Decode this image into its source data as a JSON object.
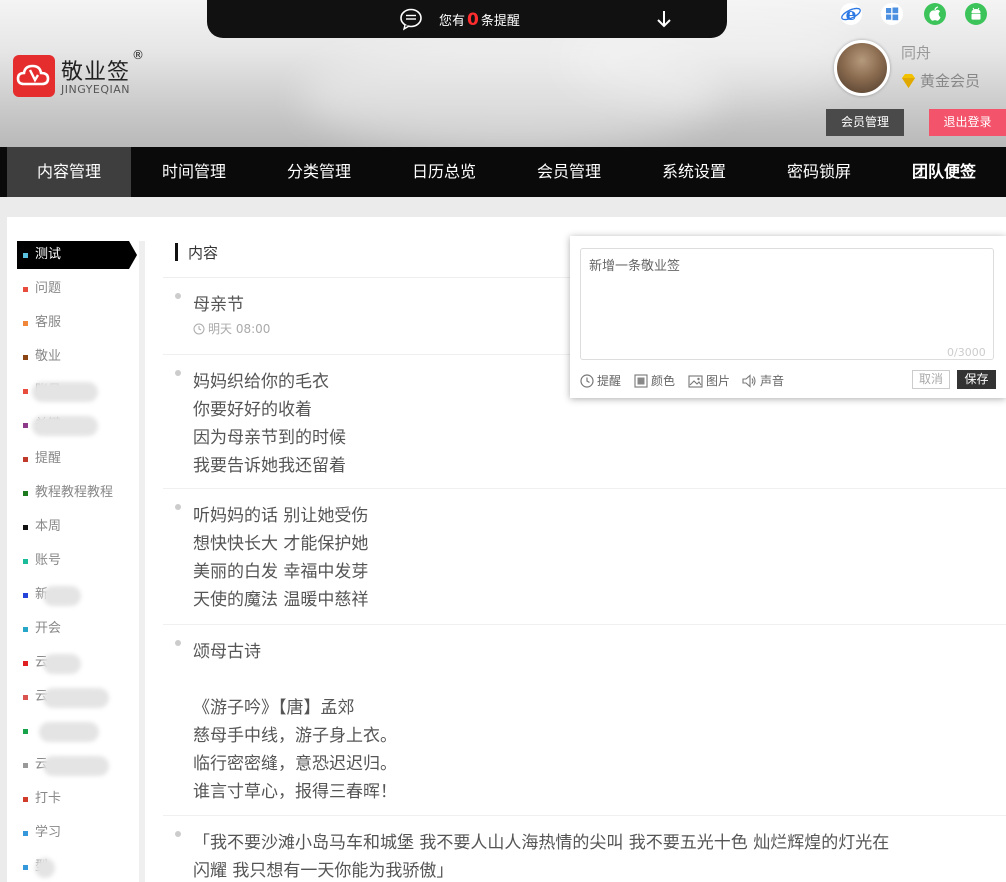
{
  "reminder": {
    "prefix": "您有",
    "count": "0",
    "suffix": "条提醒"
  },
  "logo": {
    "name": "敬业签",
    "reg": "®",
    "sub": "JINGYEQIAN"
  },
  "user": {
    "name": "同舟",
    "level": "黄金会员"
  },
  "buttons": {
    "member": "会员管理",
    "logout": "退出登录"
  },
  "nav": [
    "内容管理",
    "时间管理",
    "分类管理",
    "日历总览",
    "会员管理",
    "系统设置",
    "密码锁屏",
    "团队便签"
  ],
  "sidebar": {
    "items": [
      {
        "label": "测试",
        "color": "#5bc0de"
      },
      {
        "label": "问题",
        "color": "#e74c3c"
      },
      {
        "label": "客服",
        "color": "#f0863a"
      },
      {
        "label": "敬业",
        "color": "#8b4513"
      },
      {
        "label": "账号",
        "color": "#e74c3c"
      },
      {
        "label": "关键...",
        "color": "#8e3a8a"
      },
      {
        "label": "提醒",
        "color": "#c0392b"
      },
      {
        "label": "教程教程教程",
        "color": "#1e7a1e"
      },
      {
        "label": "本周",
        "color": "#111111"
      },
      {
        "label": "账号",
        "color": "#1abc9c"
      },
      {
        "label": "新",
        "color": "#2343d9"
      },
      {
        "label": "开会",
        "color": "#27a7c8"
      },
      {
        "label": "云",
        "color": "#e02020"
      },
      {
        "label": "云",
        "color": "#d9534f"
      },
      {
        "label": "",
        "color": "#16a34a"
      },
      {
        "label": "云",
        "color": "#999999"
      },
      {
        "label": "打卡",
        "color": "#d13b2a"
      },
      {
        "label": "学习",
        "color": "#3498db"
      },
      {
        "label": "型",
        "color": "#3498db"
      }
    ]
  },
  "content": {
    "header": "内容",
    "notes": [
      {
        "lines": [
          "母亲节"
        ],
        "time": "明天 08:00"
      },
      {
        "lines": [
          "妈妈织给你的毛衣",
          "你要好好的收着",
          "因为母亲节到的时候",
          "我要告诉她我还留着"
        ]
      },
      {
        "lines": [
          "听妈妈的话 别让她受伤",
          "想快快长大 才能保护她",
          "美丽的白发 幸福中发芽",
          "天使的魔法 温暖中慈祥"
        ]
      },
      {
        "lines": [
          "颂母古诗",
          "",
          "《游子吟》【唐】孟郊",
          "慈母手中线，游子身上衣。",
          "临行密密缝，意恐迟迟归。",
          "谁言寸草心，报得三春晖！"
        ]
      },
      {
        "lines": [
          "「我不要沙滩小岛马车和城堡 我不要人山人海热情的尖叫 我不要五光十色 灿烂辉煌的灯光在",
          "闪耀 我只想有一天你能为我骄傲」"
        ]
      }
    ]
  },
  "new_note": {
    "placeholder": "新增一条敬业签",
    "counter": "0/3000",
    "tools": [
      "提醒",
      "颜色",
      "图片",
      "声音"
    ],
    "cancel": "取消",
    "save": "保存"
  }
}
